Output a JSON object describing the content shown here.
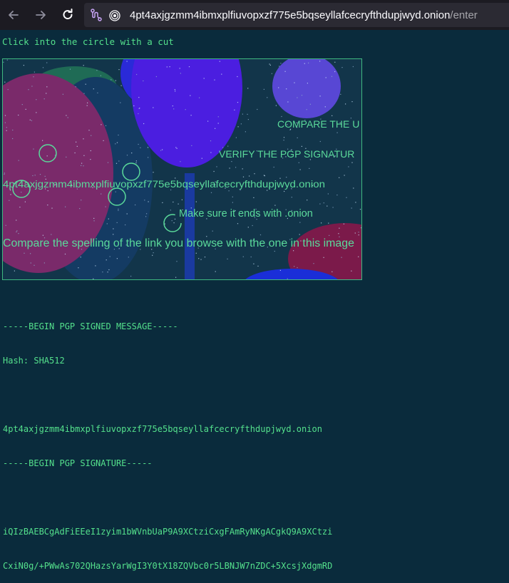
{
  "browser": {
    "url_host": "4pt4axjgzmm4ibmxplfiuvopxzf775e5bqseyllafcecryfthdupjwyd.onion",
    "url_path": "/enter"
  },
  "page": {
    "instruction": "Click into the circle with a cut"
  },
  "captcha": {
    "texts": [
      "COMPARE THE U",
      "VERIFY THE PGP SIGNATUR",
      "4pt4axjgzmm4ibmxplfiuvopxzf775e5bqseyllafcecryfthdupjwyd.onion",
      "Make sure it ends with .onion",
      "Compare the spelling of the link you browse with the one in this image"
    ]
  },
  "pgp": {
    "begin_message": "-----BEGIN PGP SIGNED MESSAGE-----",
    "hash": "Hash: SHA512",
    "body": "4pt4axjgzmm4ibmxplfiuvopxzf775e5bqseyllafcecryfthdupjwyd.onion",
    "begin_signature": "-----BEGIN PGP SIGNATURE-----",
    "sig_line1": "iQIzBAEBCgAdFiEEeI1zyim1bWVnbUaP9A9XCtziCxgFAmRyNKgACgkQ9A9XCtzi",
    "sig_line2": "CxiN0g/+PWwAs702QHazsYarWgI3Y0tX18ZQVbc0r5LBNJW7nZDC+5XcsjXdgmRD"
  }
}
